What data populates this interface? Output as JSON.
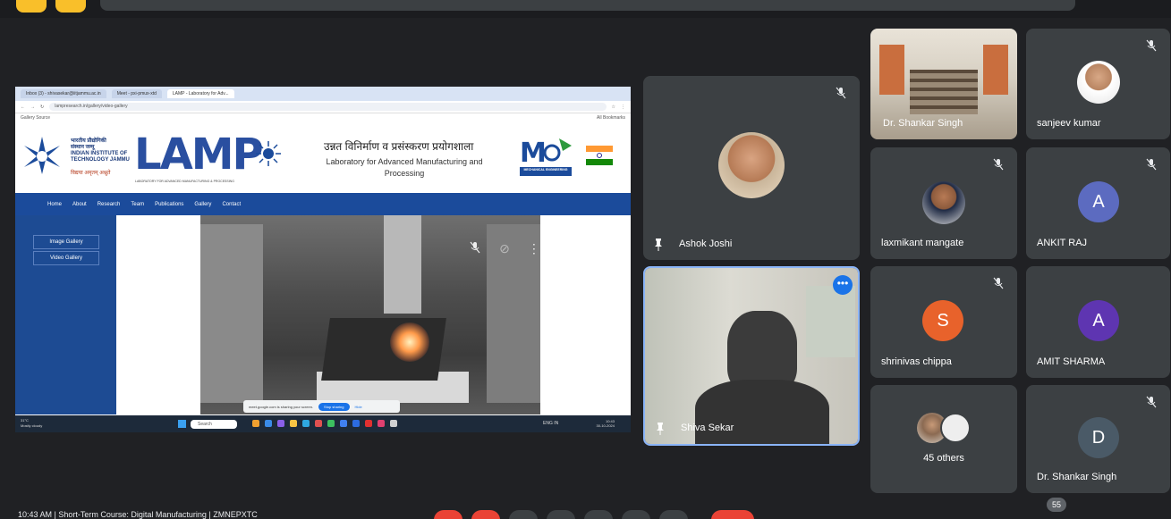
{
  "shared_screen": {
    "browser": {
      "tabs": [
        "Inbox (3) - shivasekar@iitjammu.ac.in",
        "Meet - pxi-pmux-xtd",
        "LAMP - Laboratory for Adv..."
      ],
      "url": "lampresearch.in/gallery/video-gallery",
      "bookmark_left": "Gallery Source",
      "bookmark_right": "All Bookmarks"
    },
    "site": {
      "iit_text": [
        "भारतीय प्रौद्योगिकी",
        "संस्थान जम्मू",
        "INDIAN INSTITUTE OF",
        "TECHNOLOGY JAMMU"
      ],
      "iit_motto": "विद्यया अमृतम् अश्नुते",
      "lamp_logo": "LAMP",
      "lamp_tagline": "LABORATORY FOR ADVANCED MANUFACTURING & PROCESSING",
      "title_hindi": "उन्नत विनिर्माण व प्रसंस्करण प्रयोगशाला",
      "title_en_line1": "Laboratory for Advanced Manufacturing and",
      "title_en_line2": "Processing",
      "mech_label": "MECHANICAL ENGINEERING",
      "nav": [
        "Home",
        "About",
        "Research",
        "Team",
        "Publications",
        "Gallery",
        "Contact"
      ],
      "side_menu": [
        "Image Gallery",
        "Video Gallery"
      ]
    },
    "share_notice": {
      "text": "meet.google.com is sharing your screen.",
      "stop": "Stop sharing",
      "hide": "Hide"
    },
    "taskbar": {
      "weather": [
        "31°C",
        "Mostly cloudy"
      ],
      "search": "Search",
      "lang": "ENG IN",
      "time": "10:43",
      "date": "30-10-2024"
    }
  },
  "participants": [
    {
      "name": "Ashok Joshi",
      "type": "photo",
      "pinned": true,
      "muted": true
    },
    {
      "name": "Shiva Sekar",
      "type": "video",
      "pinned": true,
      "active_speaker": true
    },
    {
      "name": "Dr. Shankar Singh",
      "type": "room-video"
    },
    {
      "name": "sanjeev kumar",
      "type": "photo",
      "muted": true
    },
    {
      "name": "laxmikant mangate",
      "type": "photo",
      "muted": true
    },
    {
      "name": "ANKIT RAJ",
      "type": "initial",
      "initial": "A",
      "color": "#5c6bc0",
      "muted": true
    },
    {
      "name": "shrinivas chippa",
      "type": "initial",
      "initial": "S",
      "color": "#e8622b",
      "muted": true
    },
    {
      "name": "AMIT SHARMA",
      "type": "initial",
      "initial": "A",
      "color": "#5e35b1"
    },
    {
      "name": "45 others",
      "type": "group"
    },
    {
      "name": "Dr. Shankar Singh",
      "type": "initial",
      "initial": "D",
      "color": "#4a5a67",
      "muted": true
    }
  ],
  "bottom": {
    "meeting_info": "10:43 AM | Short-Term Course: Digital Manufacturing | ZMNEPXTC",
    "participant_count": "55"
  },
  "colors": {
    "background": "#202124",
    "tile": "#3c4043",
    "active_border": "#8ab4f8",
    "end_call": "#ea4335"
  }
}
